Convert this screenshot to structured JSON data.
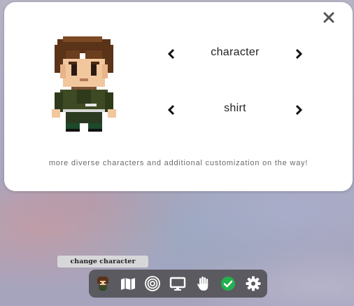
{
  "dialog": {
    "close_label": "close",
    "selectors": [
      {
        "label": "character"
      },
      {
        "label": "shirt"
      }
    ],
    "note": "more diverse characters and additional customization on the way!"
  },
  "tooltip": {
    "text": "change character"
  },
  "toolbar": {
    "items": [
      {
        "icon": "character-avatar-icon"
      },
      {
        "icon": "map-icon"
      },
      {
        "icon": "target-icon"
      },
      {
        "icon": "monitor-icon"
      },
      {
        "icon": "hand-icon"
      },
      {
        "icon": "check-circle-icon"
      },
      {
        "icon": "gear-icon"
      }
    ]
  },
  "colors": {
    "panel": "#ffffff",
    "toolbar": "#5b5a60",
    "check": "#22b14c",
    "hair": "#5a3319",
    "skin": "#f2c79e",
    "jacket": "#3e4a24"
  }
}
